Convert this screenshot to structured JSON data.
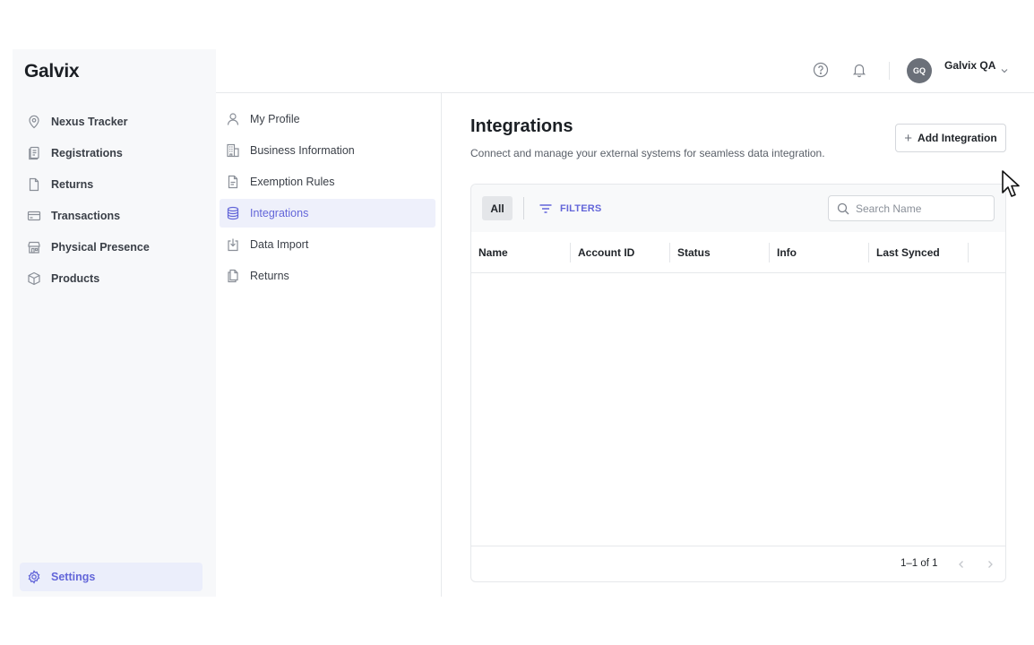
{
  "brand": {
    "name": "Galvix"
  },
  "sidebar": {
    "items": [
      {
        "label": "Nexus Tracker",
        "icon": "map-pin-icon"
      },
      {
        "label": "Registrations",
        "icon": "registrations-icon"
      },
      {
        "label": "Returns",
        "icon": "document-icon"
      },
      {
        "label": "Transactions",
        "icon": "credit-card-icon"
      },
      {
        "label": "Physical Presence",
        "icon": "storefront-icon"
      },
      {
        "label": "Products",
        "icon": "box-icon"
      }
    ],
    "settings": {
      "label": "Settings",
      "icon": "gear-icon"
    }
  },
  "topbar": {
    "user": {
      "initials": "GQ",
      "name": "Galvix QA"
    }
  },
  "subnav": {
    "items": [
      {
        "label": "My Profile",
        "icon": "user-icon"
      },
      {
        "label": "Business Information",
        "icon": "building-icon"
      },
      {
        "label": "Exemption Rules",
        "icon": "file-text-icon"
      },
      {
        "label": "Integrations",
        "icon": "database-icon",
        "active": true
      },
      {
        "label": "Data Import",
        "icon": "import-icon"
      },
      {
        "label": "Returns",
        "icon": "files-icon"
      }
    ]
  },
  "main": {
    "title": "Integrations",
    "subtitle": "Connect and manage your external systems for seamless data integration.",
    "add_button": "Add Integration",
    "toolbar": {
      "all_chip": "All",
      "filters_label": "FILTERS",
      "search_placeholder": "Search Name"
    },
    "table": {
      "columns": [
        "Name",
        "Account ID",
        "Status",
        "Info",
        "Last Synced"
      ],
      "rows": []
    },
    "pagination": {
      "range": "1–1 of 1"
    }
  },
  "colors": {
    "accent": "#6366d9",
    "active_bg": "#eef0fb",
    "sidebar_bg": "#f7f8fa",
    "avatar_bg": "#6b7079"
  }
}
